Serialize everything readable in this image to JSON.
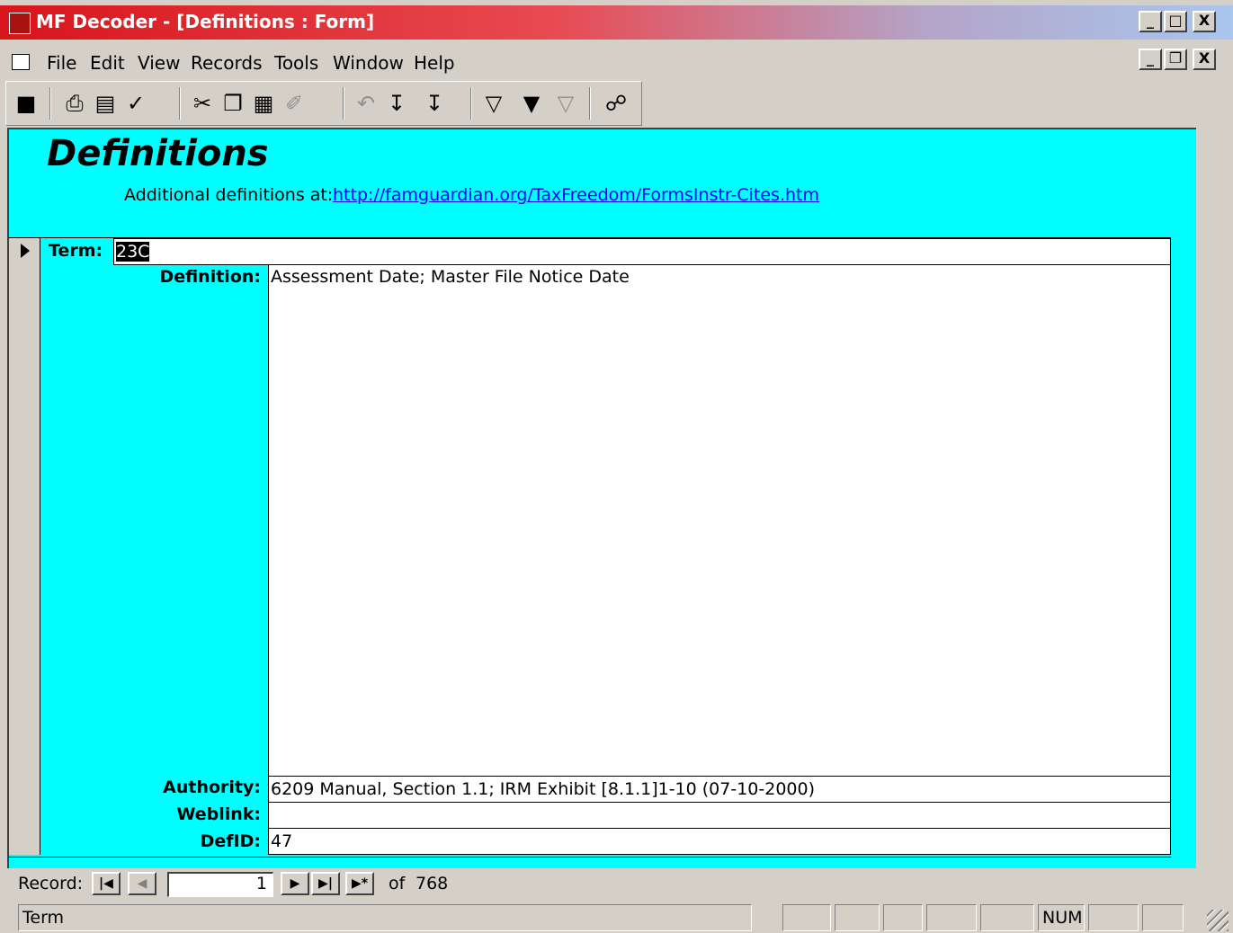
{
  "window": {
    "title": "MF Decoder - [Definitions : Form]",
    "app_controls": [
      "_",
      "□",
      "X"
    ],
    "doc_controls": [
      "_",
      "❐",
      "X"
    ]
  },
  "menu": [
    "File",
    "Edit",
    "View",
    "Records",
    "Tools",
    "Window",
    "Help"
  ],
  "toolbar": {
    "icons": [
      "save-icon",
      "print-icon",
      "print-preview-icon",
      "spelling-icon",
      "cut-icon",
      "copy-icon",
      "paste-icon",
      "format-painter-icon",
      "undo-icon",
      "sort-ascending-icon",
      "sort-descending-icon",
      "filter-by-selection-icon",
      "filter-by-form-icon",
      "apply-filter-icon",
      "find-icon"
    ]
  },
  "form": {
    "title": "Definitions",
    "additional_label": "Additional definitions at:",
    "additional_link": "http://famguardian.org/TaxFreedom/FormsInstr-Cites.htm",
    "background_color": "#00ffff",
    "term_label": "Term:",
    "term_value": "23C",
    "definition_label": "Definition:",
    "definition_value": "Assessment Date; Master File Notice Date",
    "authority_label": "Authority:",
    "authority_value": "6209 Manual, Section 1.1; IRM Exhibit [8.1.1]1-10 (07-10-2000)",
    "weblink_label": "Weblink:",
    "weblink_value": "",
    "defid_label": "DefID:",
    "defid_value": "47"
  },
  "record_nav": {
    "label": "Record:",
    "current": "1",
    "of_label": "of",
    "total": "768"
  },
  "status": {
    "text": "Term",
    "num": "NUM"
  }
}
